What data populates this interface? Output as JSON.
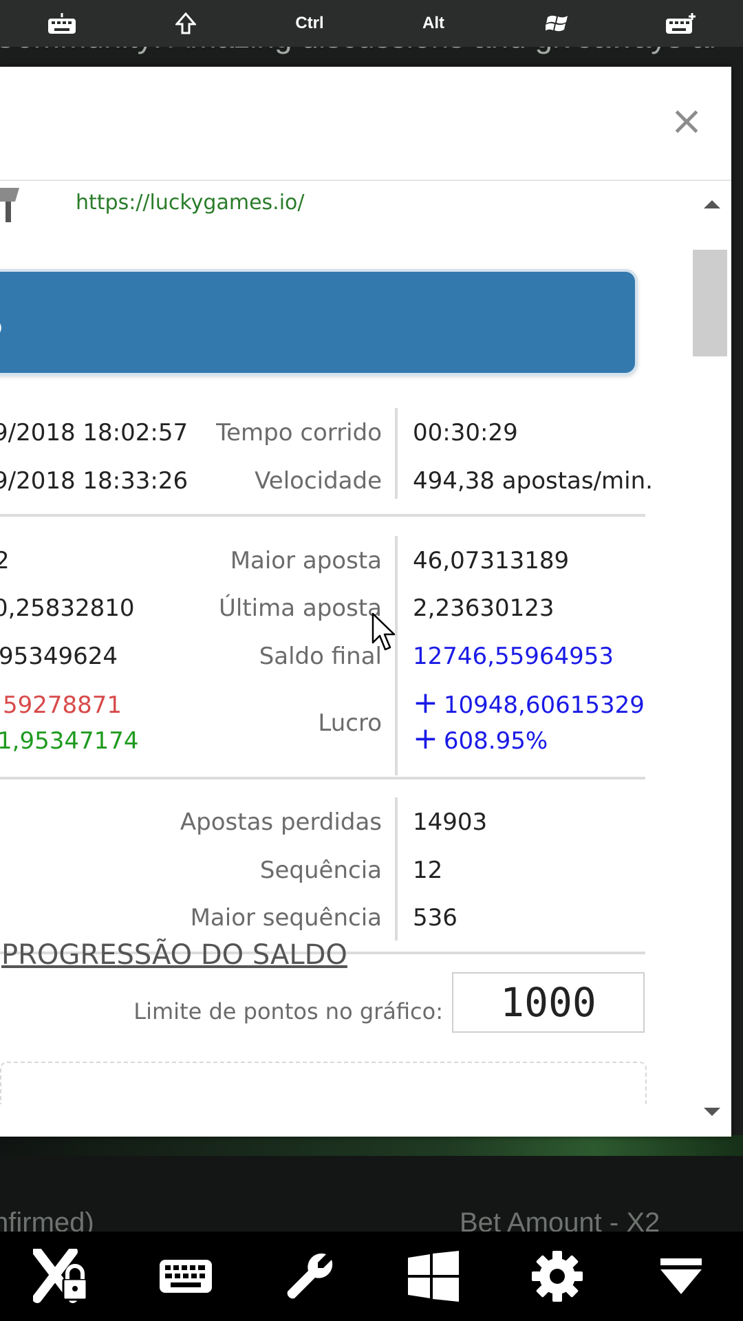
{
  "top_toolbar": {
    "keys": [
      {
        "name": "keyboard-toggle",
        "icon": "keyboard-icon"
      },
      {
        "name": "shift",
        "icon": "shift-arrow-icon"
      },
      {
        "name": "ctrl",
        "label": "Ctrl"
      },
      {
        "name": "alt",
        "label": "Alt"
      },
      {
        "name": "windows",
        "icon": "windows-flag-icon"
      },
      {
        "name": "keyboard-add",
        "icon": "keyboard-plus-icon"
      }
    ]
  },
  "background": {
    "banner_text": "Community! Amazing discussions and giveaways ar",
    "footer_left": "nfirmed)",
    "footer_right": "Bet Amount - X2"
  },
  "modal": {
    "close_label": "×",
    "url": "https://luckygames.io/",
    "title_fragment": "s",
    "time_rows": [
      {
        "left": "9/2018 18:02:57",
        "label": "Tempo corrido",
        "value": "00:30:29"
      },
      {
        "left": "9/2018 18:33:26",
        "label": "Velocidade",
        "value": "494,38 apostas/min."
      }
    ],
    "bet_rows": [
      {
        "left": "2",
        "label": "Maior aposta",
        "value": "46,07313189"
      },
      {
        "left": "0,25832810",
        "label": "Última aposta",
        "value": "2,23630123"
      },
      {
        "left": "95349624",
        "label": "Saldo final",
        "value": "12746,55964953"
      }
    ],
    "profit": {
      "left_top": "59278871",
      "left_bottom": "1,95347174",
      "label": "Lucro",
      "value_top": "10948,60615329",
      "value_bottom": "608.95%",
      "sign": "+"
    },
    "stats_rows": [
      {
        "label": "Apostas perdidas",
        "value": "14903"
      },
      {
        "label": "Sequência",
        "value": "12"
      },
      {
        "label": "Maior sequência",
        "value": "536"
      }
    ],
    "section_title": "PROGRESSÃO DO SALDO",
    "chart_limit": {
      "label": "Limite de pontos no gráfico:",
      "value": "1000"
    }
  },
  "colors": {
    "accent_blue": "#3479ad",
    "positive": "#1a1ae6",
    "loss": "#d84a4a",
    "gain": "#1e9a1e"
  },
  "bottom_toolbar": {
    "buttons": [
      {
        "name": "disconnect",
        "icon": "x-lock-icon"
      },
      {
        "name": "keyboard",
        "icon": "keyboard-icon"
      },
      {
        "name": "tools",
        "icon": "wrench-icon"
      },
      {
        "name": "windows",
        "icon": "windows-icon"
      },
      {
        "name": "settings",
        "icon": "gear-icon"
      },
      {
        "name": "collapse",
        "icon": "collapse-down-icon"
      }
    ]
  }
}
